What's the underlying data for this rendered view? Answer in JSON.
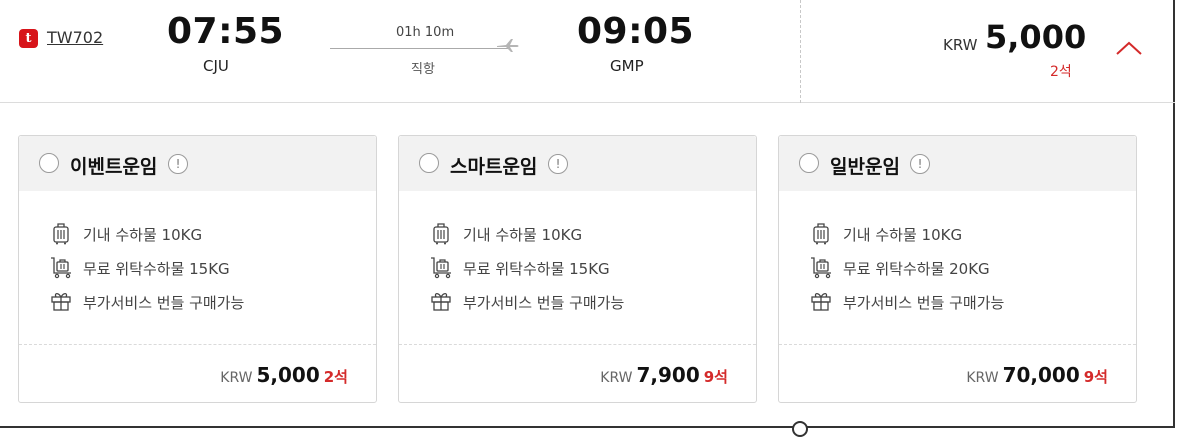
{
  "flight": {
    "airline_logo": "t",
    "flight_no": "TW702",
    "departure": {
      "time": "07:55",
      "airport": "CJU"
    },
    "arrival": {
      "time": "09:05",
      "airport": "GMP"
    },
    "duration": "01h 10m",
    "stop_type": "직항",
    "price": {
      "currency": "KRW",
      "amount": "5,000",
      "seats": "2석"
    },
    "toggle_icon": "chevron-up-icon"
  },
  "fares": [
    {
      "name": "이벤트운임",
      "info_icon": "!",
      "features": [
        {
          "icon": "carry-on-bag-icon",
          "text": "기내 수하물 10KG"
        },
        {
          "icon": "checked-luggage-cart-icon",
          "text": "무료 위탁수하물 15KG"
        },
        {
          "icon": "gift-icon",
          "text": "부가서비스 번들 구매가능"
        }
      ],
      "price": {
        "currency": "KRW",
        "amount": "5,000",
        "seats": "2석"
      }
    },
    {
      "name": "스마트운임",
      "info_icon": "!",
      "features": [
        {
          "icon": "carry-on-bag-icon",
          "text": "기내 수하물 10KG"
        },
        {
          "icon": "checked-luggage-cart-icon",
          "text": "무료 위탁수하물 15KG"
        },
        {
          "icon": "gift-icon",
          "text": "부가서비스 번들 구매가능"
        }
      ],
      "price": {
        "currency": "KRW",
        "amount": "7,900",
        "seats": "9석"
      }
    },
    {
      "name": "일반운임",
      "info_icon": "!",
      "features": [
        {
          "icon": "carry-on-bag-icon",
          "text": "기내 수하물 10KG"
        },
        {
          "icon": "checked-luggage-cart-icon",
          "text": "무료 위탁수하물 20KG"
        },
        {
          "icon": "gift-icon",
          "text": "부가서비스 번들 구매가능"
        }
      ],
      "price": {
        "currency": "KRW",
        "amount": "70,000",
        "seats": "9석"
      }
    }
  ],
  "colors": {
    "accent_red": "#d42a2a",
    "logo_red": "#d7141a",
    "header_bg": "#f2f2f2"
  }
}
